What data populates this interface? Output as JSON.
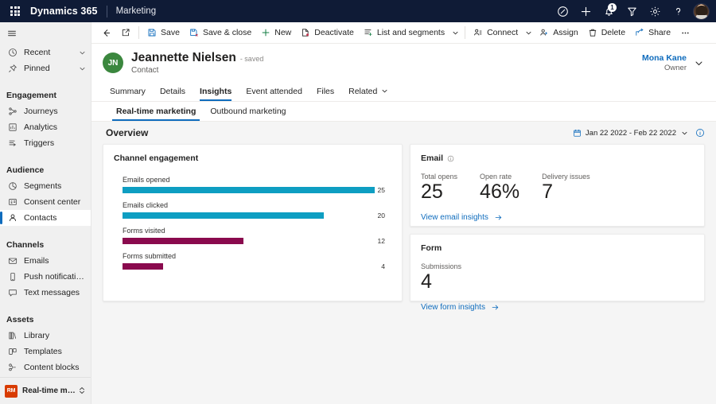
{
  "topbar": {
    "waffle": "app-launcher",
    "brand": "Dynamics 365",
    "app_name": "Marketing",
    "icons": [
      {
        "name": "compass-icon",
        "glyph": "compass"
      },
      {
        "name": "plus-icon",
        "glyph": "plus"
      },
      {
        "name": "notifications-bell-icon",
        "glyph": "bell",
        "badge": "1"
      },
      {
        "name": "filter-icon",
        "glyph": "filter"
      },
      {
        "name": "settings-gear-icon",
        "glyph": "gear"
      },
      {
        "name": "help-question-icon",
        "glyph": "question"
      }
    ]
  },
  "sidebar": {
    "quick": [
      {
        "label": "Recent",
        "icon": "clock-icon",
        "expandable": true
      },
      {
        "label": "Pinned",
        "icon": "pin-icon",
        "expandable": true
      }
    ],
    "groups": [
      {
        "title": "Engagement",
        "items": [
          {
            "label": "Journeys",
            "icon": "journeys-icon",
            "selected": false
          },
          {
            "label": "Analytics",
            "icon": "analytics-icon",
            "selected": false
          },
          {
            "label": "Triggers",
            "icon": "triggers-icon",
            "selected": false
          }
        ]
      },
      {
        "title": "Audience",
        "items": [
          {
            "label": "Segments",
            "icon": "segments-icon",
            "selected": false
          },
          {
            "label": "Consent center",
            "icon": "consent-center-icon",
            "selected": false
          },
          {
            "label": "Contacts",
            "icon": "contacts-icon",
            "selected": true
          }
        ]
      },
      {
        "title": "Channels",
        "items": [
          {
            "label": "Emails",
            "icon": "email-icon",
            "selected": false
          },
          {
            "label": "Push notifications",
            "icon": "push-notification-icon",
            "selected": false
          },
          {
            "label": "Text messages",
            "icon": "text-message-icon",
            "selected": false
          }
        ]
      },
      {
        "title": "Assets",
        "items": [
          {
            "label": "Library",
            "icon": "library-icon",
            "selected": false
          },
          {
            "label": "Templates",
            "icon": "templates-icon",
            "selected": false
          },
          {
            "label": "Content blocks",
            "icon": "content-blocks-icon",
            "selected": false
          }
        ]
      }
    ],
    "area_switcher": {
      "badge": "RM",
      "label": "Real-time marketi.."
    }
  },
  "commandbar": {
    "back": "back-arrow",
    "popout": "open-in-new-window",
    "items": [
      {
        "label": "Save",
        "icon": "save-icon"
      },
      {
        "label": "Save & close",
        "icon": "save-close-icon"
      },
      {
        "label": "New",
        "icon": "plus-icon"
      },
      {
        "label": "Deactivate",
        "icon": "deactivate-icon"
      },
      {
        "label": "List and segments",
        "icon": "list-segments-icon",
        "caret": true
      },
      {
        "label": "Connect",
        "icon": "connect-icon",
        "caret": true
      },
      {
        "label": "Assign",
        "icon": "assign-icon"
      },
      {
        "label": "Delete",
        "icon": "delete-icon"
      },
      {
        "label": "Share",
        "icon": "share-icon"
      }
    ],
    "overflow": "..."
  },
  "record": {
    "initials": "JN",
    "name": "Jeannette Nielsen",
    "saved_status": "- saved",
    "entity": "Contact",
    "owner_name": "Mona Kane",
    "owner_label": "Owner"
  },
  "tabs": [
    {
      "label": "Summary",
      "active": false
    },
    {
      "label": "Details",
      "active": false
    },
    {
      "label": "Insights",
      "active": true
    },
    {
      "label": "Event attended",
      "active": false
    },
    {
      "label": "Files",
      "active": false
    },
    {
      "label": "Related",
      "active": false,
      "caret": true
    }
  ],
  "subtabs": [
    {
      "label": "Real-time marketing",
      "active": true
    },
    {
      "label": "Outbound marketing",
      "active": false
    }
  ],
  "overview": {
    "title": "Overview",
    "date_range": "Jan 22 2022 - Feb 22 2022",
    "calendar_icon": "calendar-icon",
    "info_icon": "info-icon"
  },
  "channel_card": {
    "title": "Channel engagement"
  },
  "email_card": {
    "title": "Email",
    "info_icon": "info-icon",
    "metrics": [
      {
        "label": "Total opens",
        "value": "25"
      },
      {
        "label": "Open rate",
        "value": "46%"
      },
      {
        "label": "Delivery issues",
        "value": "7"
      }
    ],
    "link": "View email insights"
  },
  "form_card": {
    "title": "Form",
    "metrics": [
      {
        "label": "Submissions",
        "value": "4"
      }
    ],
    "link": "View form insights"
  },
  "colors": {
    "teal": "#0e9ec2",
    "magenta": "#8a0a4e",
    "accent_blue": "#0f6cbd",
    "navy": "#0f1b36",
    "avatar_green": "#3b873e",
    "rm_orange": "#d83b01"
  },
  "chart_data": {
    "type": "bar",
    "title": "Channel engagement",
    "orientation": "horizontal",
    "categories": [
      "Emails opened",
      "Emails clicked",
      "Forms visited",
      "Forms submitted"
    ],
    "values": [
      25,
      20,
      12,
      4
    ],
    "colors": [
      "#0e9ec2",
      "#0e9ec2",
      "#8a0a4e",
      "#8a0a4e"
    ],
    "max": 25,
    "xlabel": "",
    "ylabel": "",
    "grid": false,
    "legend": false,
    "data_labels": true
  }
}
